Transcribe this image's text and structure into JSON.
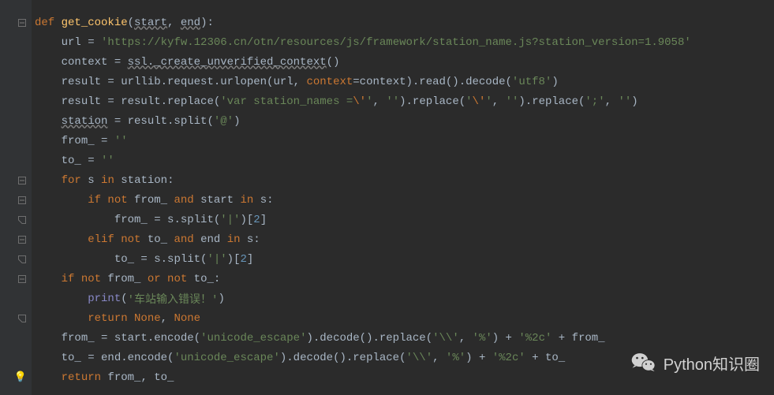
{
  "code": {
    "l1": {
      "def": "def ",
      "fn": "get_cookie",
      "p1": "(",
      "a1": "start",
      "c": ", ",
      "a2": "end",
      "p2": "):"
    },
    "l2": {
      "ind": "    ",
      "v": "url = ",
      "s": "'https://kyfw.12306.cn/otn/resources/js/framework/station_name.js?station_version=1.9058'"
    },
    "l3": {
      "ind": "    ",
      "v": "context = ",
      "call": "ssl._create_unverified_context",
      "p": "()"
    },
    "l4": {
      "ind": "    ",
      "v": "result = urllib.request.urlopen(url, ",
      "kw": "context",
      "eq": "=context).read().decode(",
      "s": "'utf8'",
      "end": ")"
    },
    "l5": {
      "ind": "    ",
      "v": "result = result.replace(",
      "s1": "'var station_names =",
      "esc1": "\\'",
      "s1b": "'",
      "c1": ", ",
      "s2": "''",
      "m1": ").replace(",
      "s3": "'",
      "esc2": "\\'",
      "s3b": "'",
      "c2": ", ",
      "s4": "''",
      "m2": ").replace(",
      "s5": "';'",
      "c3": ", ",
      "s6": "''",
      "end": ")"
    },
    "l6": {
      "ind": "    ",
      "v": "station",
      "rest": " = result.split(",
      "s": "'@'",
      "end": ")"
    },
    "l7": {
      "ind": "    ",
      "v": "from_ = ",
      "s": "''"
    },
    "l8": {
      "ind": "    ",
      "v": "to_ = ",
      "s": "''"
    },
    "l9": {
      "ind": "    ",
      "for": "for",
      "sp1": " s ",
      "in": "in",
      "sp2": " station:"
    },
    "l10": {
      "ind": "        ",
      "if": "if not",
      "v1": " from_ ",
      "and": "and",
      "v2": " start ",
      "in": "in",
      "v3": " s:"
    },
    "l11": {
      "ind": "            ",
      "v": "from_ = s.split(",
      "s": "'|'",
      "m": ")[",
      "n": "2",
      "end": "]"
    },
    "l12": {
      "ind": "        ",
      "elif": "elif not",
      "v1": " to_ ",
      "and": "and",
      "v2": " end ",
      "in": "in",
      "v3": " s:"
    },
    "l13": {
      "ind": "            ",
      "v": "to_ = s.split(",
      "s": "'|'",
      "m": ")[",
      "n": "2",
      "end": "]"
    },
    "l14": {
      "ind": "    ",
      "if": "if not",
      "v1": " from_ ",
      "or": "or not",
      "v2": " to_:"
    },
    "l15": {
      "ind": "        ",
      "fn": "print",
      "p1": "(",
      "s": "'车站输入错误！'",
      "p2": ")"
    },
    "l16": {
      "ind": "        ",
      "ret": "return ",
      "n1": "None",
      "c": ", ",
      "n2": "None"
    },
    "l17": {
      "ind": "    ",
      "v": "from_ = start.encode(",
      "s1": "'unicode_escape'",
      "m1": ").decode().replace(",
      "s2": "'\\\\'",
      "c1": ", ",
      "s3": "'%'",
      "m2": ") + ",
      "s4": "'%2c'",
      "m3": " + from_"
    },
    "l18": {
      "ind": "    ",
      "v": "to_ = end.encode(",
      "s1": "'unicode_escape'",
      "m1": ").decode().replace(",
      "s2": "'\\\\'",
      "c1": ", ",
      "s3": "'%'",
      "m2": ") + ",
      "s4": "'%2c'",
      "m3": " + to_"
    },
    "l19": {
      "ind": "    ",
      "ret": "return",
      "v": " from_, to_"
    }
  },
  "watermark": "Python知识圈"
}
